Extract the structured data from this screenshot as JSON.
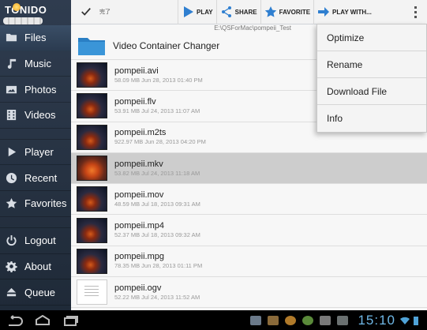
{
  "app": {
    "logo_text": "TONIDO"
  },
  "sidebar": {
    "items": [
      {
        "label": "Files",
        "icon": "folder-icon",
        "active": true
      },
      {
        "label": "Music",
        "icon": "music-icon"
      },
      {
        "label": "Photos",
        "icon": "photos-icon"
      },
      {
        "label": "Videos",
        "icon": "videos-icon"
      },
      {
        "label": "Player",
        "icon": "player-icon"
      },
      {
        "label": "Recent",
        "icon": "recent-icon"
      },
      {
        "label": "Favorites",
        "icon": "star-icon"
      },
      {
        "label": "Logout",
        "icon": "power-icon"
      },
      {
        "label": "About",
        "icon": "gear-icon"
      },
      {
        "label": "Queue",
        "icon": "queue-icon"
      }
    ]
  },
  "actionbar": {
    "done_label": "完了",
    "play_label": "PLAY",
    "share_label": "SHARE",
    "favorite_label": "FAVORITE",
    "play_with_label": "PLAY WITH..."
  },
  "content": {
    "path": "E:\\QSForMac\\pompeii_Test",
    "folder": {
      "label": "Video Container Changer"
    },
    "files": [
      {
        "name": "pompeii.avi",
        "info": "58.09 MB  Jun 28, 2013 01:40 PM",
        "thumb": "video"
      },
      {
        "name": "pompeii.flv",
        "info": "53.91 MB  Jul 24, 2013 11:07 AM",
        "thumb": "video"
      },
      {
        "name": "pompeii.m2ts",
        "info": "922.97 MB  Jun 28, 2013 04:20 PM",
        "thumb": "video"
      },
      {
        "name": "pompeii.mkv",
        "info": "53.82 MB  Jul 24, 2013 11:18 AM",
        "thumb": "bright",
        "selected": true
      },
      {
        "name": "pompeii.mov",
        "info": "48.59 MB  Jul 18, 2013 09:31 AM",
        "thumb": "video"
      },
      {
        "name": "pompeii.mp4",
        "info": "52.37 MB  Jul 18, 2013 09:32 AM",
        "thumb": "video"
      },
      {
        "name": "pompeii.mpg",
        "info": "78.35 MB  Jun 28, 2013 01:11 PM",
        "thumb": "video"
      },
      {
        "name": "pompeii.ogv",
        "info": "52.22 MB  Jul 24, 2013 11:52 AM",
        "thumb": "doc"
      }
    ]
  },
  "menu": {
    "items": [
      "Optimize",
      "Rename",
      "Download File",
      "Info"
    ]
  },
  "system": {
    "clock": "15:10"
  },
  "colors": {
    "sidebar": "#2f3c4f",
    "accent": "#2f7fd0",
    "clock": "#6fb8e6"
  }
}
